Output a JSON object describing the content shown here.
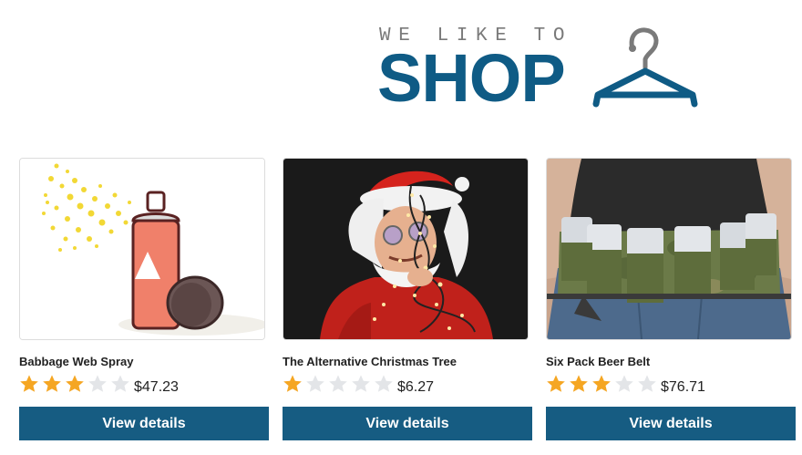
{
  "logo": {
    "tagline": "WE LIKE TO",
    "word": "SHOP",
    "icon": "hanger-icon",
    "color": "#0f5b85"
  },
  "products": [
    {
      "title": "Babbage Web Spray",
      "rating": 3,
      "max_rating": 5,
      "price": "$47.23",
      "button": "View details",
      "image": "spray-can-image"
    },
    {
      "title": "The Alternative Christmas Tree",
      "rating": 1,
      "max_rating": 5,
      "price": "$6.27",
      "button": "View details",
      "image": "santa-lights-image"
    },
    {
      "title": "Six Pack Beer Belt",
      "rating": 3,
      "max_rating": 5,
      "price": "$76.71",
      "button": "View details",
      "image": "beer-belt-image"
    }
  ],
  "colors": {
    "button": "#165c82",
    "star_filled": "#f5a623",
    "star_empty": "#e3e5e8"
  }
}
